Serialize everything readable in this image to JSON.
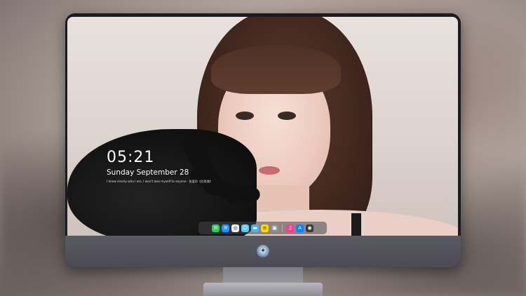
{
  "lockscreen": {
    "time": "05:21",
    "date": "Sunday September  28",
    "quote": "I know clearly who I am, I won't lose myself to anyone · 张爱玲《红玫瑰》"
  },
  "dock": {
    "icons": [
      {
        "name": "messages-icon",
        "glyph": "✉",
        "color": "#34c759"
      },
      {
        "name": "mail-icon",
        "glyph": "✉",
        "color": "#1e90ff"
      },
      {
        "name": "safari-icon",
        "glyph": "◎",
        "color": "#f2f2f2"
      },
      {
        "name": "finder-icon",
        "glyph": "☺",
        "color": "#5ac8fa"
      },
      {
        "name": "clips-icon",
        "glyph": "▬",
        "color": "#4fb3e8"
      },
      {
        "name": "notes-icon",
        "glyph": "≡",
        "color": "#ffd60a"
      },
      {
        "name": "photos-icon",
        "glyph": "▣",
        "color": "#8e8e93"
      },
      {
        "name": "music-icon",
        "glyph": "♫",
        "color": "#ff3b8d"
      },
      {
        "name": "app-store-icon",
        "glyph": "A",
        "color": "#0a84ff"
      },
      {
        "name": "camera-icon",
        "glyph": "◉",
        "color": "#3a3a3c"
      }
    ]
  },
  "monitor": {
    "logo_glyph": "✦"
  }
}
